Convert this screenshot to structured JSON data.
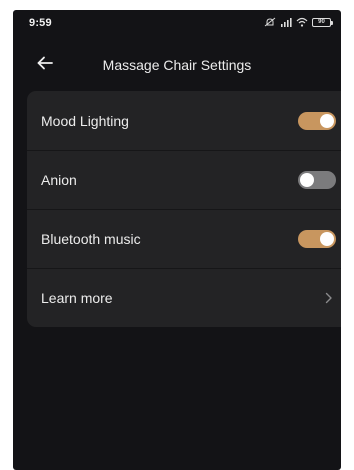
{
  "status_bar": {
    "time": "9:59",
    "battery_level": "90",
    "icons": [
      "mute-icon",
      "signal-icon",
      "wifi-icon",
      "battery-icon"
    ]
  },
  "header": {
    "back_icon": "arrow-left-icon",
    "title": "Massage Chair Settings"
  },
  "settings": {
    "items": [
      {
        "label": "Mood Lighting",
        "control": "toggle",
        "on": true
      },
      {
        "label": "Anion",
        "control": "toggle",
        "on": false
      },
      {
        "label": "Bluetooth music",
        "control": "toggle",
        "on": true
      },
      {
        "label": "Learn more",
        "control": "chevron",
        "icon": "chevron-right-icon"
      }
    ]
  },
  "colors": {
    "background": "#131316",
    "card": "#232325",
    "toggle_on": "#c8965f",
    "toggle_off": "#7b7b7d"
  }
}
